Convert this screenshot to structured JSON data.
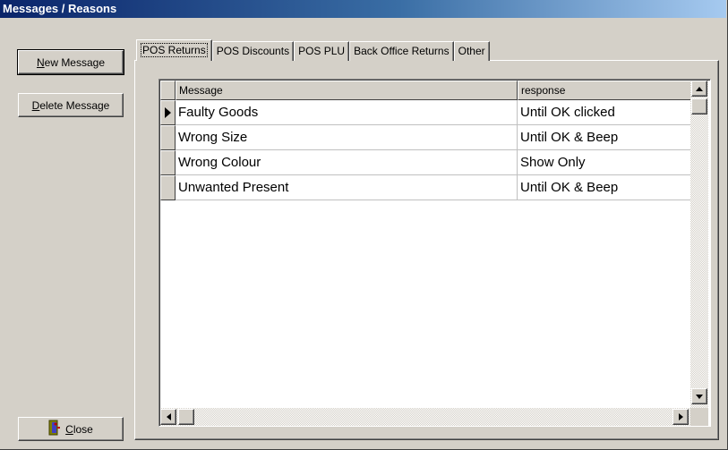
{
  "window": {
    "title": "Messages / Reasons"
  },
  "buttons": {
    "new_message_ul": "N",
    "new_message_rest": "ew Message",
    "delete_message_ul": "D",
    "delete_message_rest": "elete Message",
    "close_ul": "C",
    "close_rest": "lose"
  },
  "tabs": [
    {
      "label": "POS Returns",
      "active": true
    },
    {
      "label": "POS Discounts"
    },
    {
      "label": "POS PLU"
    },
    {
      "label": "Back Office Returns"
    },
    {
      "label": "Other"
    }
  ],
  "grid": {
    "columns": [
      "Message",
      "response"
    ],
    "rows": [
      {
        "message": "Faulty Goods",
        "response": "Until OK clicked",
        "current": true
      },
      {
        "message": "Wrong Size",
        "response": "Until OK & Beep"
      },
      {
        "message": "Wrong Colour",
        "response": "Show Only"
      },
      {
        "message": "Unwanted Present",
        "response": "Until OK & Beep"
      }
    ]
  },
  "icons": {
    "close": "door-exit-icon",
    "row_indicator": "current-row-arrow-icon"
  },
  "colors": {
    "title_start": "#0a246a",
    "title_end": "#a6caf0",
    "face": "#d4d0c8"
  }
}
